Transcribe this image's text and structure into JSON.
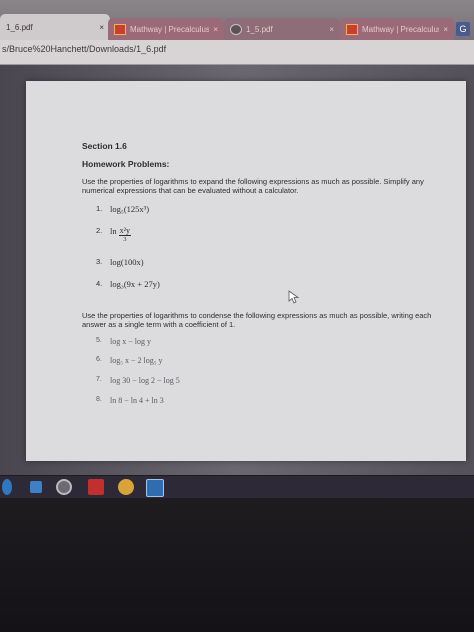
{
  "browser": {
    "tabs": [
      {
        "label": "1_6.pdf",
        "close": "×"
      },
      {
        "label": "Mathway | Precalculus P",
        "close": "×"
      },
      {
        "label": "1_5.pdf",
        "close": "×"
      },
      {
        "label": "Mathway | Precalculus P",
        "close": "×"
      }
    ],
    "new_tab": "G",
    "address": "s/Bruce%20Hanchett/Downloads/1_6.pdf"
  },
  "document": {
    "section": "Section 1.6",
    "heading": "Homework Problems:",
    "instructions_expand": "Use the properties of logarithms to expand the following expressions as much as possible. Simplify any numerical expressions that can be evaluated without a calculator.",
    "expand_problems": [
      {
        "num": "1.",
        "expr": "log₅(125x³)"
      },
      {
        "num": "2.",
        "prefix": "ln",
        "numerator": "x²y",
        "denominator": "3"
      },
      {
        "num": "3.",
        "expr": "log(100x)"
      },
      {
        "num": "4.",
        "expr": "log₃(9x + 27y)"
      }
    ],
    "instructions_condense": "Use the properties of logarithms to condense the following expressions as much as possible, writing each answer as a single term with a coefficient of 1.",
    "condense_problems": [
      {
        "num": "5.",
        "expr": "log x − log y"
      },
      {
        "num": "6.",
        "expr": "log₅ x − 2 log₅ y"
      },
      {
        "num": "7.",
        "expr": "log 30 − log 2 − log 5"
      },
      {
        "num": "8.",
        "expr": "ln 8 − ln 4 + ln 3"
      }
    ]
  },
  "taskbar": {
    "icons": [
      "edge-icon",
      "windows-explorer-icon",
      "chrome-icon",
      "app-icon",
      "app-icon",
      "store-icon"
    ]
  }
}
